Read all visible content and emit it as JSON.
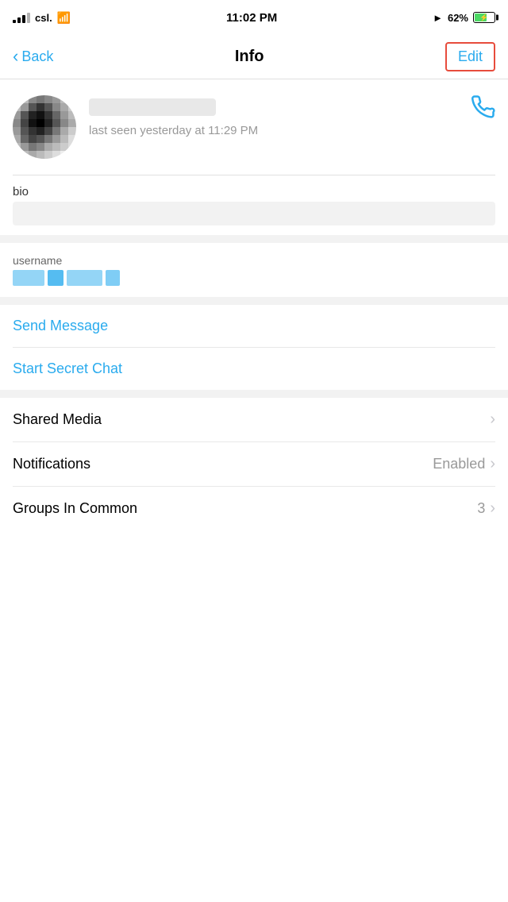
{
  "statusBar": {
    "carrier": "csl.",
    "time": "11:02 PM",
    "battery": "62%"
  },
  "navBar": {
    "backLabel": "Back",
    "title": "Info",
    "editLabel": "Edit"
  },
  "profile": {
    "lastSeen": "last seen yesterday at 11:29 PM",
    "bioLabel": "bio",
    "usernameLabel": "username"
  },
  "actions": {
    "sendMessage": "Send Message",
    "startSecretChat": "Start Secret Chat"
  },
  "settings": [
    {
      "label": "Shared Media",
      "value": "",
      "showChevron": true
    },
    {
      "label": "Notifications",
      "value": "Enabled",
      "showChevron": true
    },
    {
      "label": "Groups In Common",
      "value": "3",
      "showChevron": true
    }
  ]
}
